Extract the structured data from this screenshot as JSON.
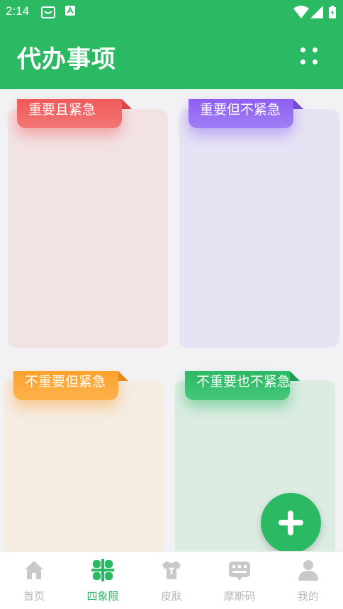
{
  "status_bar": {
    "time": "2:14"
  },
  "app_bar": {
    "title": "代办事项",
    "menu_icon": "grid-dots-icon"
  },
  "quadrants": [
    {
      "label": "重要且紧急",
      "color": "#f05a5a"
    },
    {
      "label": "重要但不紧急",
      "color": "#8e60f2"
    },
    {
      "label": "不重要但紧急",
      "color": "#fca22e"
    },
    {
      "label": "不重要也不紧急",
      "color": "#2bb964"
    }
  ],
  "fab": {
    "icon": "plus-icon"
  },
  "bottom_nav": {
    "items": [
      {
        "label": "首页",
        "icon": "home-icon"
      },
      {
        "label": "四象限",
        "icon": "quadrant-icon",
        "active": true
      },
      {
        "label": "皮肤",
        "icon": "shirt-icon"
      },
      {
        "label": "摩斯码",
        "icon": "keyboard-icon"
      },
      {
        "label": "我的",
        "icon": "user-icon"
      }
    ]
  },
  "colors": {
    "primary": "#2bb964",
    "inactive": "#b7b7b7"
  }
}
